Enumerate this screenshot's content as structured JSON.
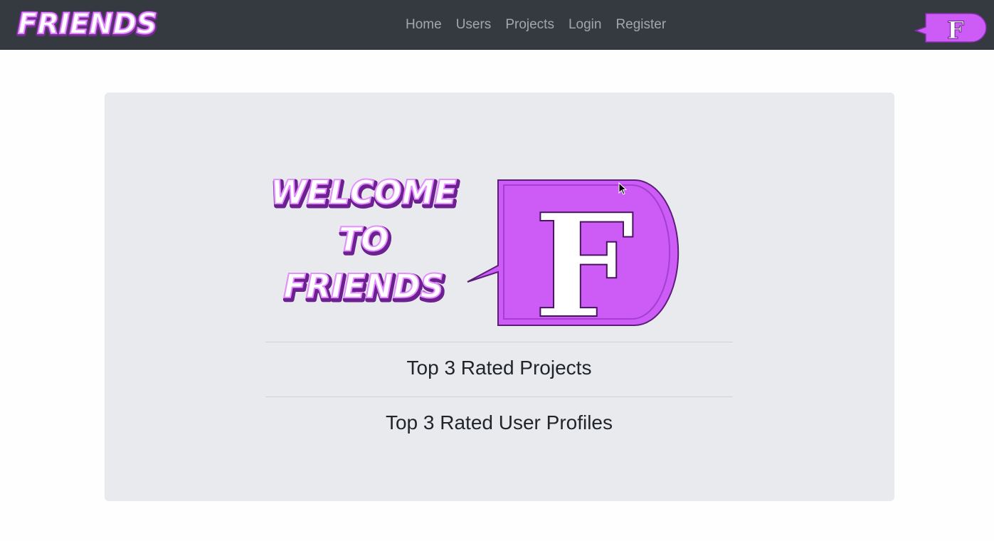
{
  "brand": {
    "text": "FRIENDS",
    "logo_letter": "F"
  },
  "nav": {
    "items": [
      {
        "label": "Home"
      },
      {
        "label": "Users"
      },
      {
        "label": "Projects"
      },
      {
        "label": "Login"
      },
      {
        "label": "Register"
      }
    ]
  },
  "hero": {
    "welcome_lines": [
      "WELCOME",
      "TO",
      "FRIENDS"
    ],
    "logo_letter": "F"
  },
  "sections": {
    "projects_title": "Top 3 Rated Projects",
    "users_title": "Top 3 Rated User Profiles"
  },
  "colors": {
    "navbar": "#343a40",
    "brand_purple": "#cc5cf5",
    "jumbotron": "#e8eaed"
  }
}
